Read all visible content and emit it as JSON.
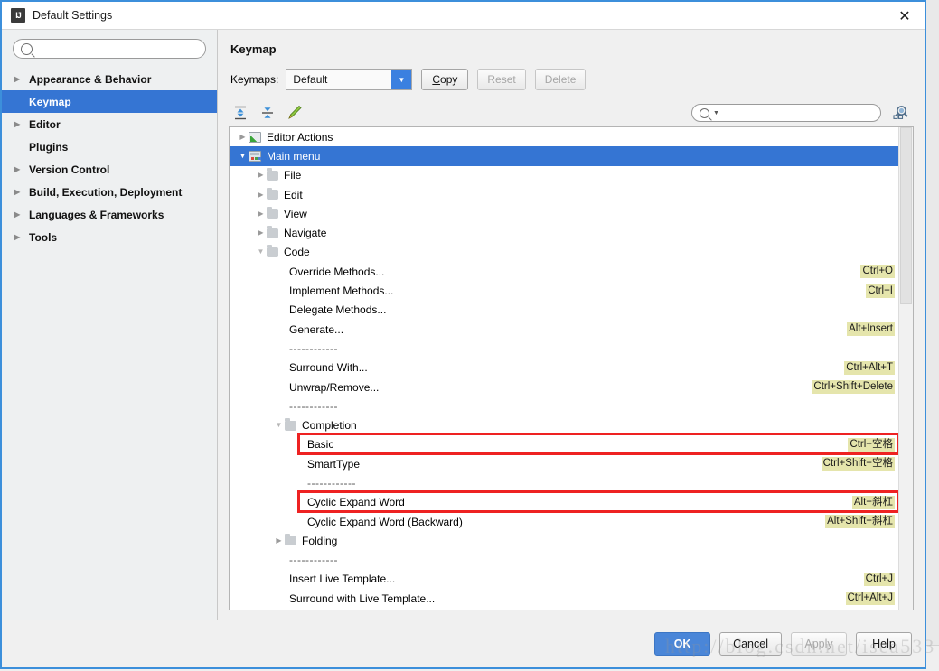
{
  "window": {
    "title": "Default Settings",
    "app_icon": "IJ",
    "close_icon": "✕"
  },
  "sidebar": {
    "search_placeholder": "",
    "search_value": "",
    "search_icon": "search-icon",
    "items": [
      {
        "label": "Appearance & Behavior",
        "has_arrow": true,
        "selected": false
      },
      {
        "label": "Keymap",
        "has_arrow": false,
        "selected": true
      },
      {
        "label": "Editor",
        "has_arrow": true,
        "selected": false
      },
      {
        "label": "Plugins",
        "has_arrow": false,
        "selected": false
      },
      {
        "label": "Version Control",
        "has_arrow": true,
        "selected": false
      },
      {
        "label": "Build, Execution, Deployment",
        "has_arrow": true,
        "selected": false
      },
      {
        "label": "Languages & Frameworks",
        "has_arrow": true,
        "selected": false
      },
      {
        "label": "Tools",
        "has_arrow": true,
        "selected": false
      }
    ]
  },
  "panel": {
    "title": "Keymap",
    "keymaps_label": "Keymaps:",
    "keymap_selected": "Default",
    "keymap_options": [
      "Default"
    ],
    "dropdown_icon": "chevron-down-icon",
    "buttons": {
      "copy": {
        "label": "Copy",
        "mnemonic": "C",
        "enabled": true
      },
      "reset": {
        "label": "Reset",
        "enabled": false
      },
      "delete": {
        "label": "Delete",
        "enabled": false
      }
    },
    "toolbar": {
      "expand_all_icon": "expand-all-icon",
      "collapse_all_icon": "collapse-all-icon",
      "edit_shortcut_icon": "pencil-edit-icon",
      "find_shortcut_icon": "find-by-shortcut-icon",
      "search_placeholder": "",
      "search_value": "",
      "search_icon": "search-icon"
    }
  },
  "tree": {
    "rows": [
      {
        "indent": 0,
        "arrow": "collapsed",
        "icon": "action-group-icon",
        "label": "Editor Actions",
        "shortcut": "",
        "selected": false,
        "highlight": false
      },
      {
        "indent": 0,
        "arrow": "expanded",
        "icon": "main-menu-icon",
        "label": "Main menu",
        "shortcut": "",
        "selected": true,
        "highlight": false
      },
      {
        "indent": 1,
        "arrow": "collapsed",
        "icon": "folder-icon",
        "label": "File",
        "shortcut": "",
        "selected": false,
        "highlight": false
      },
      {
        "indent": 1,
        "arrow": "collapsed",
        "icon": "folder-icon",
        "label": "Edit",
        "shortcut": "",
        "selected": false,
        "highlight": false
      },
      {
        "indent": 1,
        "arrow": "collapsed",
        "icon": "folder-icon",
        "label": "View",
        "shortcut": "",
        "selected": false,
        "highlight": false
      },
      {
        "indent": 1,
        "arrow": "collapsed",
        "icon": "folder-icon",
        "label": "Navigate",
        "shortcut": "",
        "selected": false,
        "highlight": false
      },
      {
        "indent": 1,
        "arrow": "expanded",
        "icon": "folder-icon",
        "label": "Code",
        "shortcut": "",
        "selected": false,
        "highlight": false
      },
      {
        "indent": 2,
        "arrow": "none",
        "icon": "none",
        "label": "Override Methods...",
        "shortcut": "Ctrl+O",
        "selected": false,
        "highlight": false
      },
      {
        "indent": 2,
        "arrow": "none",
        "icon": "none",
        "label": "Implement Methods...",
        "shortcut": "Ctrl+I",
        "selected": false,
        "highlight": false
      },
      {
        "indent": 2,
        "arrow": "none",
        "icon": "none",
        "label": "Delegate Methods...",
        "shortcut": "",
        "selected": false,
        "highlight": false
      },
      {
        "indent": 2,
        "arrow": "none",
        "icon": "none",
        "label": "Generate...",
        "shortcut": "Alt+Insert",
        "selected": false,
        "highlight": false
      },
      {
        "indent": 2,
        "arrow": "none",
        "icon": "none",
        "label": "------------",
        "shortcut": "",
        "separator": true,
        "selected": false,
        "highlight": false
      },
      {
        "indent": 2,
        "arrow": "none",
        "icon": "none",
        "label": "Surround With...",
        "shortcut": "Ctrl+Alt+T",
        "selected": false,
        "highlight": false
      },
      {
        "indent": 2,
        "arrow": "none",
        "icon": "none",
        "label": "Unwrap/Remove...",
        "shortcut": "Ctrl+Shift+Delete",
        "selected": false,
        "highlight": false
      },
      {
        "indent": 2,
        "arrow": "none",
        "icon": "none",
        "label": "------------",
        "shortcut": "",
        "separator": true,
        "selected": false,
        "highlight": false
      },
      {
        "indent": 2,
        "arrow": "expanded",
        "icon": "folder-icon",
        "label": "Completion",
        "shortcut": "",
        "selected": false,
        "highlight": false
      },
      {
        "indent": 3,
        "arrow": "none",
        "icon": "none",
        "label": "Basic",
        "shortcut": "Ctrl+空格",
        "selected": false,
        "highlight": true
      },
      {
        "indent": 3,
        "arrow": "none",
        "icon": "none",
        "label": "SmartType",
        "shortcut": "Ctrl+Shift+空格",
        "selected": false,
        "highlight": false
      },
      {
        "indent": 3,
        "arrow": "none",
        "icon": "none",
        "label": "------------",
        "shortcut": "",
        "separator": true,
        "selected": false,
        "highlight": false
      },
      {
        "indent": 3,
        "arrow": "none",
        "icon": "none",
        "label": "Cyclic Expand Word",
        "shortcut": "Alt+斜杠",
        "selected": false,
        "highlight": true
      },
      {
        "indent": 3,
        "arrow": "none",
        "icon": "none",
        "label": "Cyclic Expand Word (Backward)",
        "shortcut": "Alt+Shift+斜杠",
        "selected": false,
        "highlight": false
      },
      {
        "indent": 2,
        "arrow": "collapsed",
        "icon": "folder-icon",
        "label": "Folding",
        "shortcut": "",
        "selected": false,
        "highlight": false
      },
      {
        "indent": 2,
        "arrow": "none",
        "icon": "none",
        "label": "------------",
        "shortcut": "",
        "separator": true,
        "selected": false,
        "highlight": false
      },
      {
        "indent": 2,
        "arrow": "none",
        "icon": "none",
        "label": "Insert Live Template...",
        "shortcut": "Ctrl+J",
        "selected": false,
        "highlight": false
      },
      {
        "indent": 2,
        "arrow": "none",
        "icon": "none",
        "label": "Surround with Live Template...",
        "shortcut": "Ctrl+Alt+J",
        "selected": false,
        "highlight": false
      }
    ]
  },
  "footer": {
    "ok": "OK",
    "cancel": "Cancel",
    "apply": "Apply",
    "apply_enabled": false,
    "help": "Help"
  },
  "watermark": "http://blog.csdn.net/isea533",
  "colors": {
    "selection_blue": "#3575d3",
    "accent_blue": "#3b80e0",
    "dialog_border": "#3c8fdb",
    "shortcut_bg": "#e5e5ac",
    "highlight_red": "#ee2222",
    "primary_button": "#4a86d8"
  }
}
